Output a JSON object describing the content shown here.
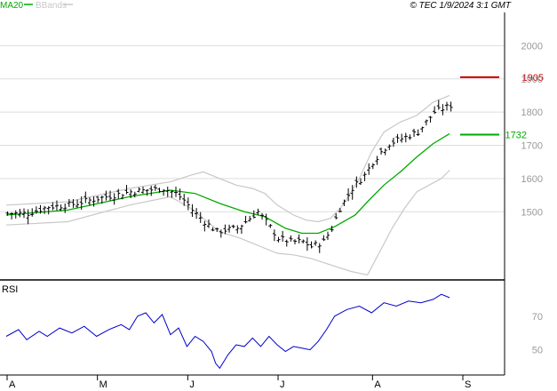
{
  "legend": {
    "ma_label": "MA20",
    "bb_label": "BBands"
  },
  "copyright": "© TEC 1/9/2024 3:1 GMT",
  "rsi_label": "RSI",
  "colors": {
    "ma": "#00aa00",
    "bbands": "#c8c8c8",
    "price": "#000000",
    "rsi": "#0000cc",
    "resistance": "#cc0000",
    "support": "#00aa00",
    "grid": "#dddddd"
  },
  "chart_data": [
    {
      "type": "ohlc",
      "panel": "price",
      "ylim": [
        1300,
        2100
      ],
      "yticks": [
        "2000",
        "1900",
        "1800",
        "1700",
        "1600",
        "1500"
      ],
      "ytick_values": [
        2000,
        1900,
        1800,
        1700,
        1600,
        1500
      ],
      "x_month_labels": [
        "A",
        "M",
        "J",
        "J",
        "A",
        "S"
      ],
      "x_month_index": [
        0,
        22,
        44,
        66,
        89,
        111
      ],
      "n_days": 111,
      "price_path": [
        [
          0,
          1495
        ],
        [
          5,
          1495
        ],
        [
          10,
          1515
        ],
        [
          15,
          1520
        ],
        [
          22,
          1540
        ],
        [
          30,
          1560
        ],
        [
          38,
          1570
        ],
        [
          41,
          1555
        ],
        [
          43,
          1535
        ],
        [
          45,
          1505
        ],
        [
          48,
          1470
        ],
        [
          51,
          1440
        ],
        [
          53,
          1445
        ],
        [
          56,
          1450
        ],
        [
          59,
          1480
        ],
        [
          61,
          1500
        ],
        [
          63,
          1470
        ],
        [
          66,
          1420
        ],
        [
          69,
          1410
        ],
        [
          72,
          1410
        ],
        [
          74,
          1395
        ],
        [
          77,
          1410
        ],
        [
          79,
          1450
        ],
        [
          81,
          1510
        ],
        [
          84,
          1570
        ],
        [
          87,
          1610
        ],
        [
          89,
          1650
        ],
        [
          91,
          1680
        ],
        [
          93,
          1705
        ],
        [
          96,
          1720
        ],
        [
          100,
          1740
        ],
        [
          102,
          1770
        ],
        [
          104,
          1800
        ],
        [
          106,
          1810
        ],
        [
          108,
          1820
        ]
      ],
      "ma20_path": [
        [
          0,
          1490
        ],
        [
          15,
          1505
        ],
        [
          30,
          1545
        ],
        [
          40,
          1565
        ],
        [
          46,
          1555
        ],
        [
          52,
          1525
        ],
        [
          58,
          1500
        ],
        [
          63,
          1485
        ],
        [
          68,
          1450
        ],
        [
          72,
          1435
        ],
        [
          76,
          1435
        ],
        [
          80,
          1455
        ],
        [
          85,
          1490
        ],
        [
          88,
          1530
        ],
        [
          92,
          1580
        ],
        [
          96,
          1620
        ],
        [
          100,
          1665
        ],
        [
          104,
          1705
        ],
        [
          108,
          1735
        ]
      ],
      "bb_upper_path": [
        [
          0,
          1520
        ],
        [
          15,
          1530
        ],
        [
          30,
          1570
        ],
        [
          40,
          1590
        ],
        [
          45,
          1610
        ],
        [
          48,
          1620
        ],
        [
          52,
          1600
        ],
        [
          56,
          1580
        ],
        [
          60,
          1570
        ],
        [
          63,
          1555
        ],
        [
          66,
          1520
        ],
        [
          70,
          1490
        ],
        [
          73,
          1475
        ],
        [
          76,
          1470
        ],
        [
          79,
          1480
        ],
        [
          82,
          1520
        ],
        [
          86,
          1600
        ],
        [
          89,
          1680
        ],
        [
          92,
          1740
        ],
        [
          96,
          1770
        ],
        [
          100,
          1790
        ],
        [
          104,
          1830
        ],
        [
          108,
          1850
        ]
      ],
      "bb_lower_path": [
        [
          0,
          1460
        ],
        [
          15,
          1470
        ],
        [
          30,
          1520
        ],
        [
          40,
          1545
        ],
        [
          45,
          1510
        ],
        [
          48,
          1480
        ],
        [
          52,
          1440
        ],
        [
          57,
          1420
        ],
        [
          62,
          1395
        ],
        [
          66,
          1375
        ],
        [
          70,
          1370
        ],
        [
          74,
          1360
        ],
        [
          79,
          1340
        ],
        [
          84,
          1320
        ],
        [
          88,
          1310
        ],
        [
          91,
          1380
        ],
        [
          94,
          1450
        ],
        [
          97,
          1510
        ],
        [
          100,
          1560
        ],
        [
          103,
          1580
        ],
        [
          106,
          1600
        ],
        [
          108,
          1625
        ]
      ],
      "resistance": {
        "label": "1905",
        "value": 1905
      },
      "support": {
        "label": "1732",
        "value": 1732
      }
    },
    {
      "type": "line",
      "panel": "rsi",
      "name": "RSI",
      "ylim": [
        35,
        90
      ],
      "yticks": [
        "70",
        "50"
      ],
      "ytick_values": [
        70,
        50
      ],
      "rsi_path": [
        [
          0,
          58
        ],
        [
          3,
          62
        ],
        [
          5,
          56
        ],
        [
          8,
          61
        ],
        [
          10,
          58
        ],
        [
          13,
          63
        ],
        [
          16,
          60
        ],
        [
          19,
          64
        ],
        [
          22,
          58
        ],
        [
          25,
          62
        ],
        [
          28,
          65
        ],
        [
          30,
          62
        ],
        [
          32,
          70
        ],
        [
          34,
          72
        ],
        [
          36,
          66
        ],
        [
          38,
          71
        ],
        [
          40,
          59
        ],
        [
          42,
          63
        ],
        [
          44,
          52
        ],
        [
          46,
          58
        ],
        [
          48,
          55
        ],
        [
          50,
          49
        ],
        [
          51,
          42
        ],
        [
          52,
          39
        ],
        [
          54,
          47
        ],
        [
          56,
          53
        ],
        [
          58,
          52
        ],
        [
          60,
          57
        ],
        [
          62,
          52
        ],
        [
          64,
          58
        ],
        [
          66,
          53
        ],
        [
          68,
          49
        ],
        [
          70,
          52
        ],
        [
          72,
          51
        ],
        [
          74,
          50
        ],
        [
          76,
          55
        ],
        [
          78,
          62
        ],
        [
          80,
          70
        ],
        [
          83,
          74
        ],
        [
          86,
          76
        ],
        [
          89,
          72
        ],
        [
          92,
          78
        ],
        [
          95,
          76
        ],
        [
          98,
          79
        ],
        [
          101,
          78
        ],
        [
          104,
          80
        ],
        [
          106,
          83
        ],
        [
          108,
          81
        ]
      ]
    }
  ]
}
